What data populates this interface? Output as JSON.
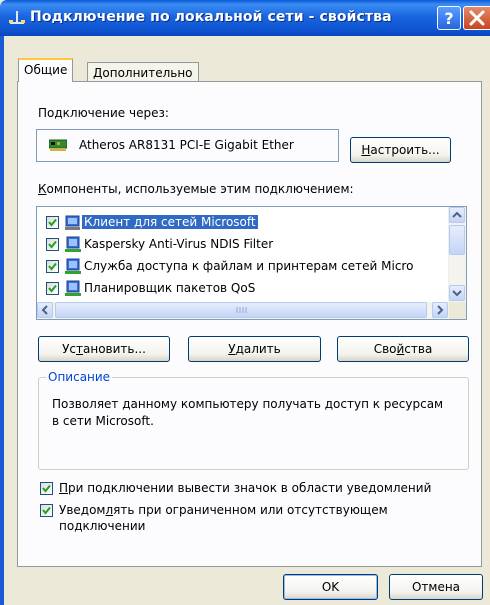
{
  "window": {
    "title": "Подключение по локальной сети - свойства",
    "help_icon": "help-icon",
    "close_icon": "close-icon"
  },
  "tabs": [
    {
      "label": "Общие",
      "active": true
    },
    {
      "label": "Дополнительно",
      "active": false
    }
  ],
  "connect_via": {
    "label": "Подключение через:",
    "adapter": "Atheros AR8131 PCI-E Gigabit Ether",
    "configure_button_prefix": "",
    "configure_button_accel": "Н",
    "configure_button_rest": "астроить..."
  },
  "components": {
    "label_accel": "К",
    "label_rest": "омпоненты, используемые этим подключением:",
    "items": [
      {
        "label": "Клиент для сетей Microsoft",
        "checked": true,
        "selected": true
      },
      {
        "label": "Kaspersky Anti-Virus NDIS Filter",
        "checked": true,
        "selected": false
      },
      {
        "label": "Служба доступа к файлам и принтерам сетей Micro",
        "checked": true,
        "selected": false
      },
      {
        "label": "Планировщик пакетов QoS",
        "checked": true,
        "selected": false
      }
    ]
  },
  "buttons": {
    "install_a": "Ус",
    "install_accel": "т",
    "install_b": "ановить...",
    "remove_accel": "У",
    "remove_rest": "далить",
    "properties_a": "Сво",
    "properties_accel": "й",
    "properties_b": "ства"
  },
  "description": {
    "title": "Описание",
    "text": "Позволяет данному компьютеру получать доступ к ресурсам в сети Microsoft."
  },
  "options": [
    {
      "accel": "П",
      "label": "ри подключении вывести значок в области уведомлений",
      "checked": true
    },
    {
      "label_a": "Уведом",
      "accel": "л",
      "label_b": "ять при ограниченном или отсутствующем",
      "line2": "подключении",
      "checked": true
    }
  ],
  "footer": {
    "ok": "OK",
    "cancel": "Отмена"
  },
  "colors": {
    "titlebar": "#0a5ad8",
    "selection": "#316ac5",
    "group_title": "#0046d5",
    "tab_highlight": "#ffc83c"
  }
}
